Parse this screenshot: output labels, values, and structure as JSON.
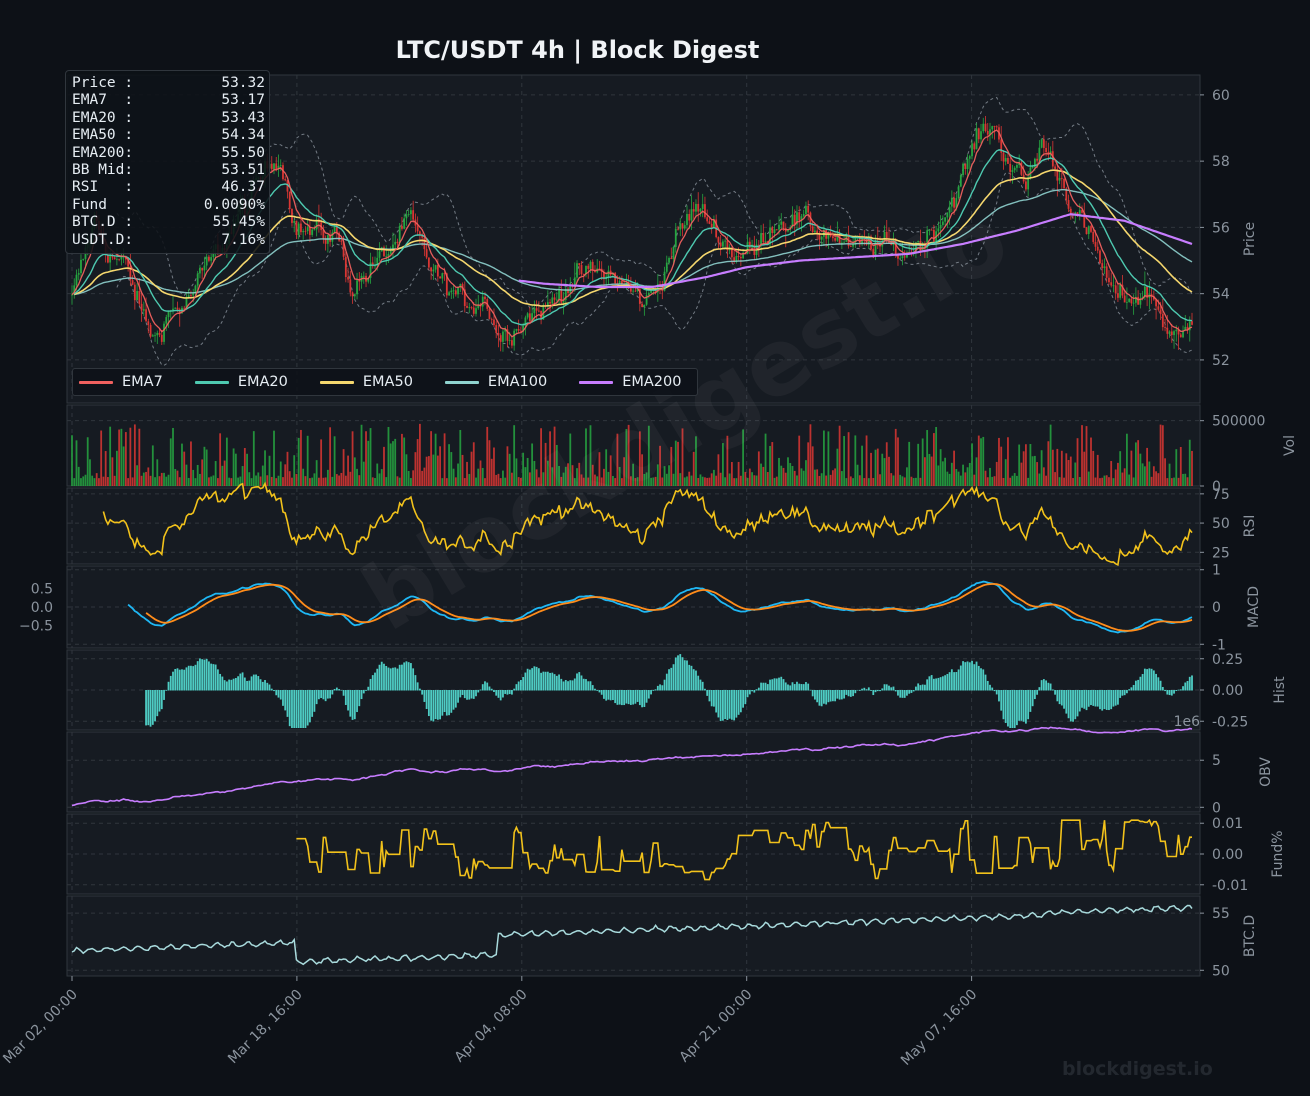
{
  "title": "LTC/USDT  4h  |  Block Digest",
  "watermark": "blockdigest.io",
  "info_box": [
    {
      "label": "Price :",
      "value": "53.32"
    },
    {
      "label": "EMA7  :",
      "value": "53.17"
    },
    {
      "label": "EMA20 :",
      "value": "53.43"
    },
    {
      "label": "EMA50 :",
      "value": "54.34"
    },
    {
      "label": "EMA200:",
      "value": "55.50"
    },
    {
      "label": "BB Mid:",
      "value": "53.51"
    },
    {
      "label": "RSI   :",
      "value": "46.37"
    },
    {
      "label": "Fund  :",
      "value": "0.0090%"
    },
    {
      "label": "BTC.D :",
      "value": "55.45%"
    },
    {
      "label": "USDT.D:",
      "value": "7.16%"
    }
  ],
  "legend": [
    {
      "name": "EMA7",
      "color": "#f0615f"
    },
    {
      "name": "EMA20",
      "color": "#4ec9b0"
    },
    {
      "name": "EMA50",
      "color": "#f5d76e"
    },
    {
      "name": "EMA100",
      "color": "#8fd3cf"
    },
    {
      "name": "EMA200",
      "color": "#c77dff"
    }
  ],
  "colors": {
    "background": "#0d1117",
    "panel": "#161b22",
    "grid": "#30363d",
    "text": "#8b949e",
    "up": "#26a641",
    "down": "#da3633",
    "rsi": "#f2c21b",
    "macd": "#1fb8f5",
    "signal": "#ff8c1a",
    "hist": "#4ecdc4",
    "obv": "#c77dff",
    "fund": "#f2c21b",
    "btcd": "#a8dadc",
    "bb": "#8b949e"
  },
  "chart_data": {
    "type": "line",
    "x_range": [
      "Mar 02, 00:00",
      "May 24, 00:00"
    ],
    "x_ticks": [
      "Mar 02, 00:00",
      "Mar 18, 16:00",
      "Apr 04, 08:00",
      "Apr 21, 00:00",
      "May 07, 16:00"
    ],
    "panels": [
      {
        "name": "Price",
        "ylabel": "Price",
        "ylim": [
          50.7,
          60.6
        ],
        "yticks": [
          "52",
          "54",
          "56",
          "58",
          "60"
        ],
        "price_path": [
          [
            "Mar 02, 00:00",
            53.8
          ],
          [
            "Mar 03, 16:00",
            56.2
          ],
          [
            "Mar 04, 20:00",
            55.2
          ],
          [
            "Mar 06, 00:00",
            54.8
          ],
          [
            "Mar 07, 04:00",
            53.4
          ],
          [
            "Mar 08, 04:00",
            52.6
          ],
          [
            "Mar 09, 00:00",
            53.4
          ],
          [
            "Mar 10, 12:00",
            53.7
          ],
          [
            "Mar 12, 00:00",
            54.8
          ],
          [
            "Mar 13, 08:00",
            55.6
          ],
          [
            "Mar 14, 20:00",
            56.6
          ],
          [
            "Mar 16, 04:00",
            57.6
          ],
          [
            "Mar 17, 08:00",
            58.3
          ],
          [
            "Mar 18, 16:00",
            56.0
          ],
          [
            "Mar 20, 00:00",
            55.8
          ],
          [
            "Mar 21, 16:00",
            55.8
          ],
          [
            "Mar 22, 16:00",
            54.2
          ],
          [
            "Mar 23, 20:00",
            54.6
          ],
          [
            "Mar 25, 08:00",
            55.2
          ],
          [
            "Mar 27, 00:00",
            56.2
          ],
          [
            "Mar 28, 08:00",
            55.0
          ],
          [
            "Mar 29, 16:00",
            54.2
          ],
          [
            "Mar 31, 04:00",
            53.7
          ],
          [
            "Apr 01, 16:00",
            53.9
          ],
          [
            "Apr 02, 16:00",
            52.7
          ],
          [
            "Apr 03, 16:00",
            53.0
          ],
          [
            "Apr 04, 20:00",
            53.4
          ],
          [
            "Apr 06, 08:00",
            53.6
          ],
          [
            "Apr 07, 20:00",
            54.4
          ],
          [
            "Apr 09, 00:00",
            54.6
          ],
          [
            "Apr 10, 20:00",
            54.6
          ],
          [
            "Apr 12, 00:00",
            54.2
          ],
          [
            "Apr 13, 12:00",
            53.7
          ],
          [
            "Apr 14, 16:00",
            54.5
          ],
          [
            "Apr 15, 16:00",
            55.6
          ],
          [
            "Apr 17, 04:00",
            56.6
          ],
          [
            "Apr 18, 16:00",
            56.0
          ],
          [
            "Apr 20, 00:00",
            55.2
          ],
          [
            "Apr 21, 16:00",
            55.3
          ],
          [
            "Apr 23, 00:00",
            56.2
          ],
          [
            "Apr 24, 08:00",
            56.3
          ],
          [
            "Apr 25, 20:00",
            56.0
          ],
          [
            "Apr 27, 08:00",
            55.8
          ],
          [
            "Apr 28, 16:00",
            55.3
          ],
          [
            "Apr 30, 00:00",
            55.5
          ],
          [
            "May 01, 08:00",
            55.4
          ],
          [
            "May 02, 16:00",
            55.2
          ],
          [
            "May 04, 00:00",
            55.6
          ],
          [
            "May 05, 08:00",
            56.2
          ],
          [
            "May 06, 16:00",
            57.2
          ],
          [
            "May 08, 00:00",
            58.6
          ],
          [
            "May 09, 04:00",
            59.2
          ],
          [
            "May 10, 08:00",
            58.1
          ],
          [
            "May 11, 16:00",
            57.2
          ],
          [
            "May 12, 20:00",
            58.6
          ],
          [
            "May 14, 04:00",
            57.6
          ],
          [
            "May 15, 16:00",
            56.2
          ],
          [
            "May 17, 00:00",
            55.2
          ],
          [
            "May 18, 04:00",
            53.9
          ],
          [
            "May 19, 16:00",
            53.9
          ],
          [
            "May 21, 00:00",
            54.0
          ],
          [
            "May 22, 08:00",
            52.8
          ],
          [
            "May 23, 04:00",
            52.5
          ],
          [
            "May 24, 00:00",
            53.3
          ]
        ],
        "ema200_path": [
          [
            "Apr 04, 00:00",
            54.4
          ],
          [
            "Apr 06, 00:00",
            54.3
          ],
          [
            "Apr 10, 00:00",
            54.2
          ],
          [
            "Apr 14, 00:00",
            54.2
          ],
          [
            "Apr 18, 00:00",
            54.5
          ],
          [
            "Apr 21, 00:00",
            54.8
          ],
          [
            "Apr 25, 00:00",
            55.0
          ],
          [
            "Apr 29, 00:00",
            55.1
          ],
          [
            "May 03, 00:00",
            55.2
          ],
          [
            "May 07, 00:00",
            55.5
          ],
          [
            "May 11, 00:00",
            55.9
          ],
          [
            "May 15, 00:00",
            56.4
          ],
          [
            "May 19, 00:00",
            56.2
          ],
          [
            "May 24, 00:00",
            55.5
          ]
        ]
      },
      {
        "name": "Volume",
        "ylabel": "Vol",
        "ylim": [
          0,
          620000
        ],
        "yticks": [
          "0",
          "500000"
        ]
      },
      {
        "name": "RSI",
        "ylabel": "RSI",
        "ylim": [
          15,
          80
        ],
        "yticks": [
          "25",
          "50",
          "75"
        ]
      },
      {
        "name": "MACD",
        "ylabel": "MACD",
        "ylim": [
          -1.1,
          1.1
        ],
        "yticks": [
          "-1",
          "0",
          "1"
        ],
        "left_yticks": [
          "-0.5",
          "0.0",
          "0.5"
        ]
      },
      {
        "name": "Histogram",
        "ylabel": "Hist",
        "ylim": [
          -0.32,
          0.32
        ],
        "yticks": [
          "-0.25",
          "0.00",
          "0.25"
        ],
        "offset_label": "1e6"
      },
      {
        "name": "OBV",
        "ylabel": "OBV",
        "ylim": [
          -0.5,
          8
        ],
        "yticks": [
          "0",
          "5"
        ]
      },
      {
        "name": "Funding",
        "ylabel": "Fund%",
        "ylim": [
          -0.013,
          0.013
        ],
        "yticks": [
          "-0.01",
          "0.00",
          "0.01"
        ]
      },
      {
        "name": "BTC Dominance",
        "ylabel": "BTC.D",
        "ylim": [
          49.5,
          56.5
        ],
        "yticks": [
          "50",
          "55"
        ]
      }
    ]
  }
}
